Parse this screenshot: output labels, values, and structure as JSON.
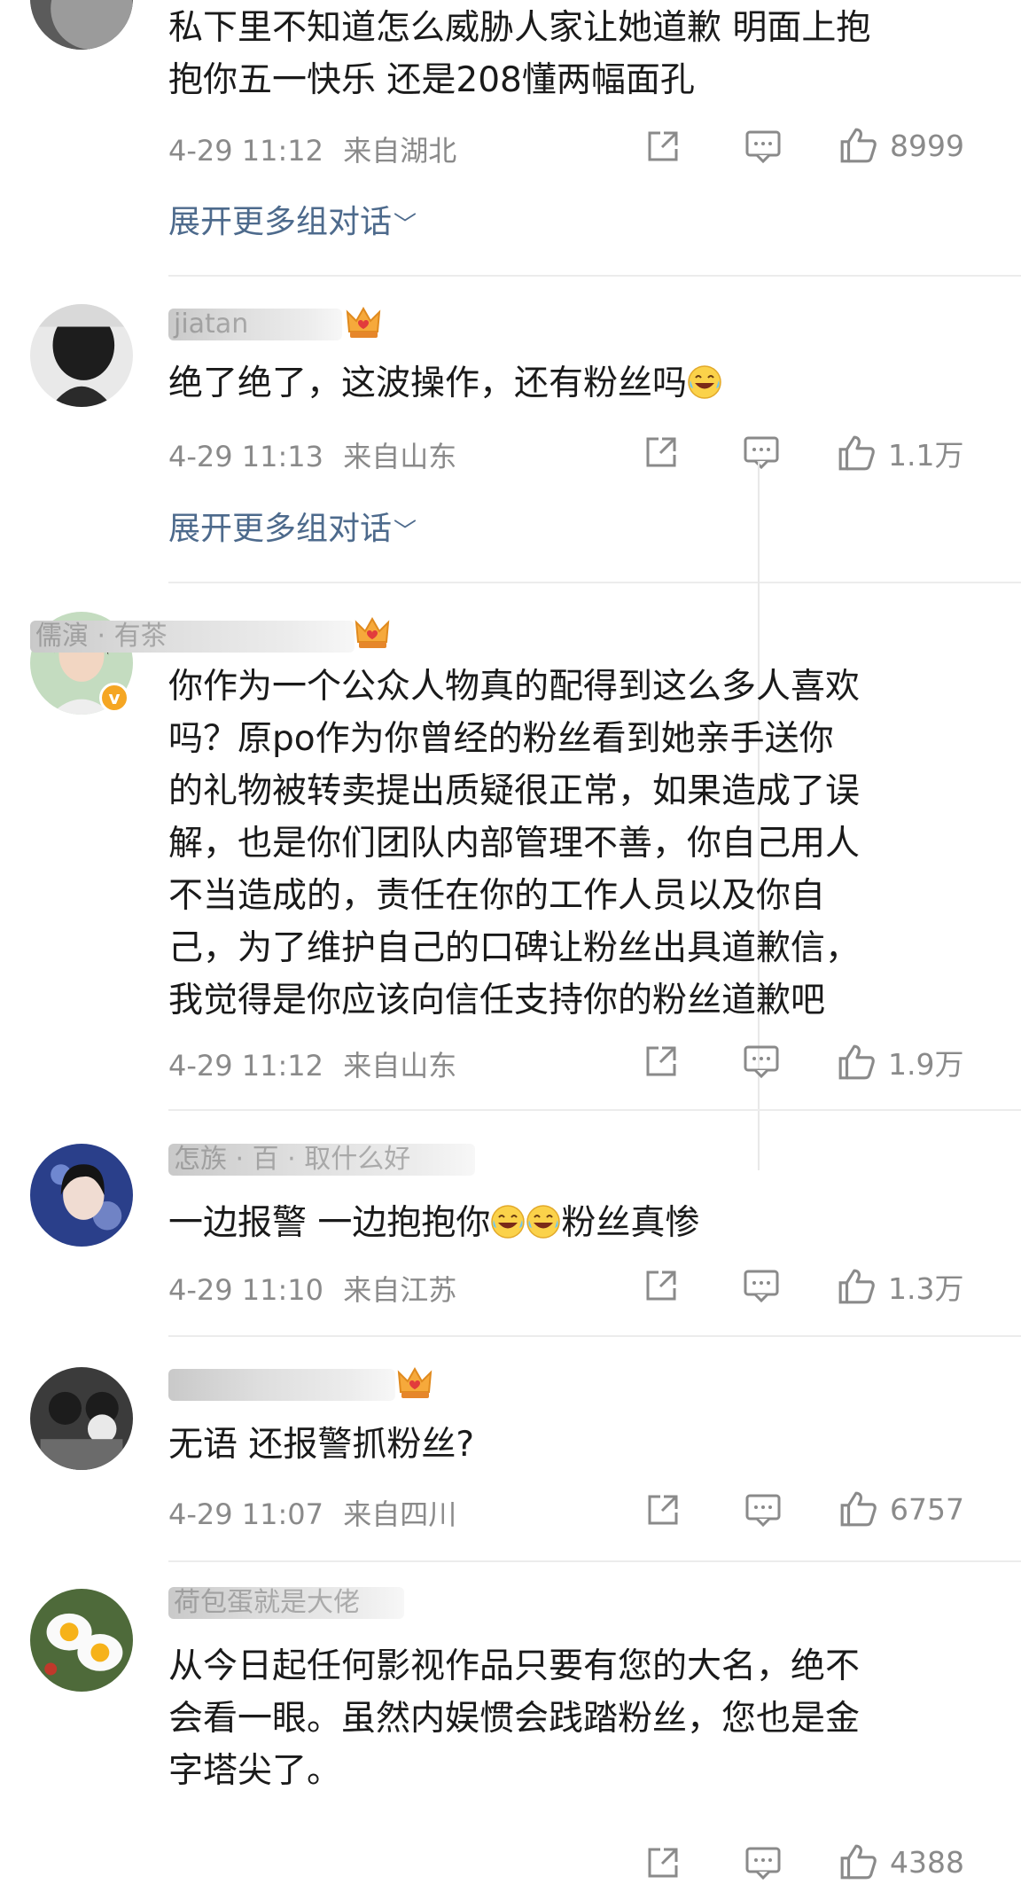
{
  "comments": [
    {
      "username": "",
      "text_lines": [
        "私下里不知道怎么威胁人家让她道歉 明面上抱",
        "抱你五一快乐 还是208懂两幅面孔"
      ],
      "time": "4-29 11:12",
      "location": "来自湖北",
      "likes": "8999",
      "expand": "展开更多组对话"
    },
    {
      "username": "jiatan",
      "text": "绝了绝了，这波操作，还有粉丝吗",
      "emoji": "laughing-tears-icon",
      "time": "4-29 11:13",
      "location": "来自山东",
      "likes": "1.1万",
      "expand": "展开更多组对话"
    },
    {
      "username": "儒演 · 有茶",
      "verified": "v",
      "text_lines": [
        "你作为一个公众人物真的配得到这么多人喜欢",
        "吗？原po作为你曾经的粉丝看到她亲手送你",
        "的礼物被转卖提出质疑很正常，如果造成了误",
        "解，也是你们团队内部管理不善，你自己用人",
        "不当造成的，责任在你的工作人员以及你自",
        "己，为了维护自己的口碑让粉丝出具道歉信，",
        "我觉得是你应该向信任支持你的粉丝道歉吧"
      ],
      "time": "4-29 11:12",
      "location": "来自山东",
      "likes": "1.9万"
    },
    {
      "username": "怎族 · 百 · 取什么好",
      "text_a": "一边报警 一边抱抱你",
      "text_b": "粉丝真惨",
      "emoji": "crying-laughing-icon",
      "time": "4-29 11:10",
      "location": "来自江苏",
      "likes": "1.3万"
    },
    {
      "username": "",
      "text": "无语 还报警抓粉丝?",
      "time": "4-29 11:07",
      "location": "来自四川",
      "likes": "6757"
    },
    {
      "username": "荷包蛋就是大佬",
      "text_lines": [
        "从今日起任何影视作品只要有您的大名，绝不",
        "会看一眼。虽然内娱惯会践踏粉丝，您也是金",
        "字塔尖了。"
      ],
      "likes": "4388"
    }
  ],
  "colors": {
    "meta": "#8a8a8a",
    "link": "#4d6a8c",
    "divider": "#ececec",
    "badge": "#f5a623"
  }
}
